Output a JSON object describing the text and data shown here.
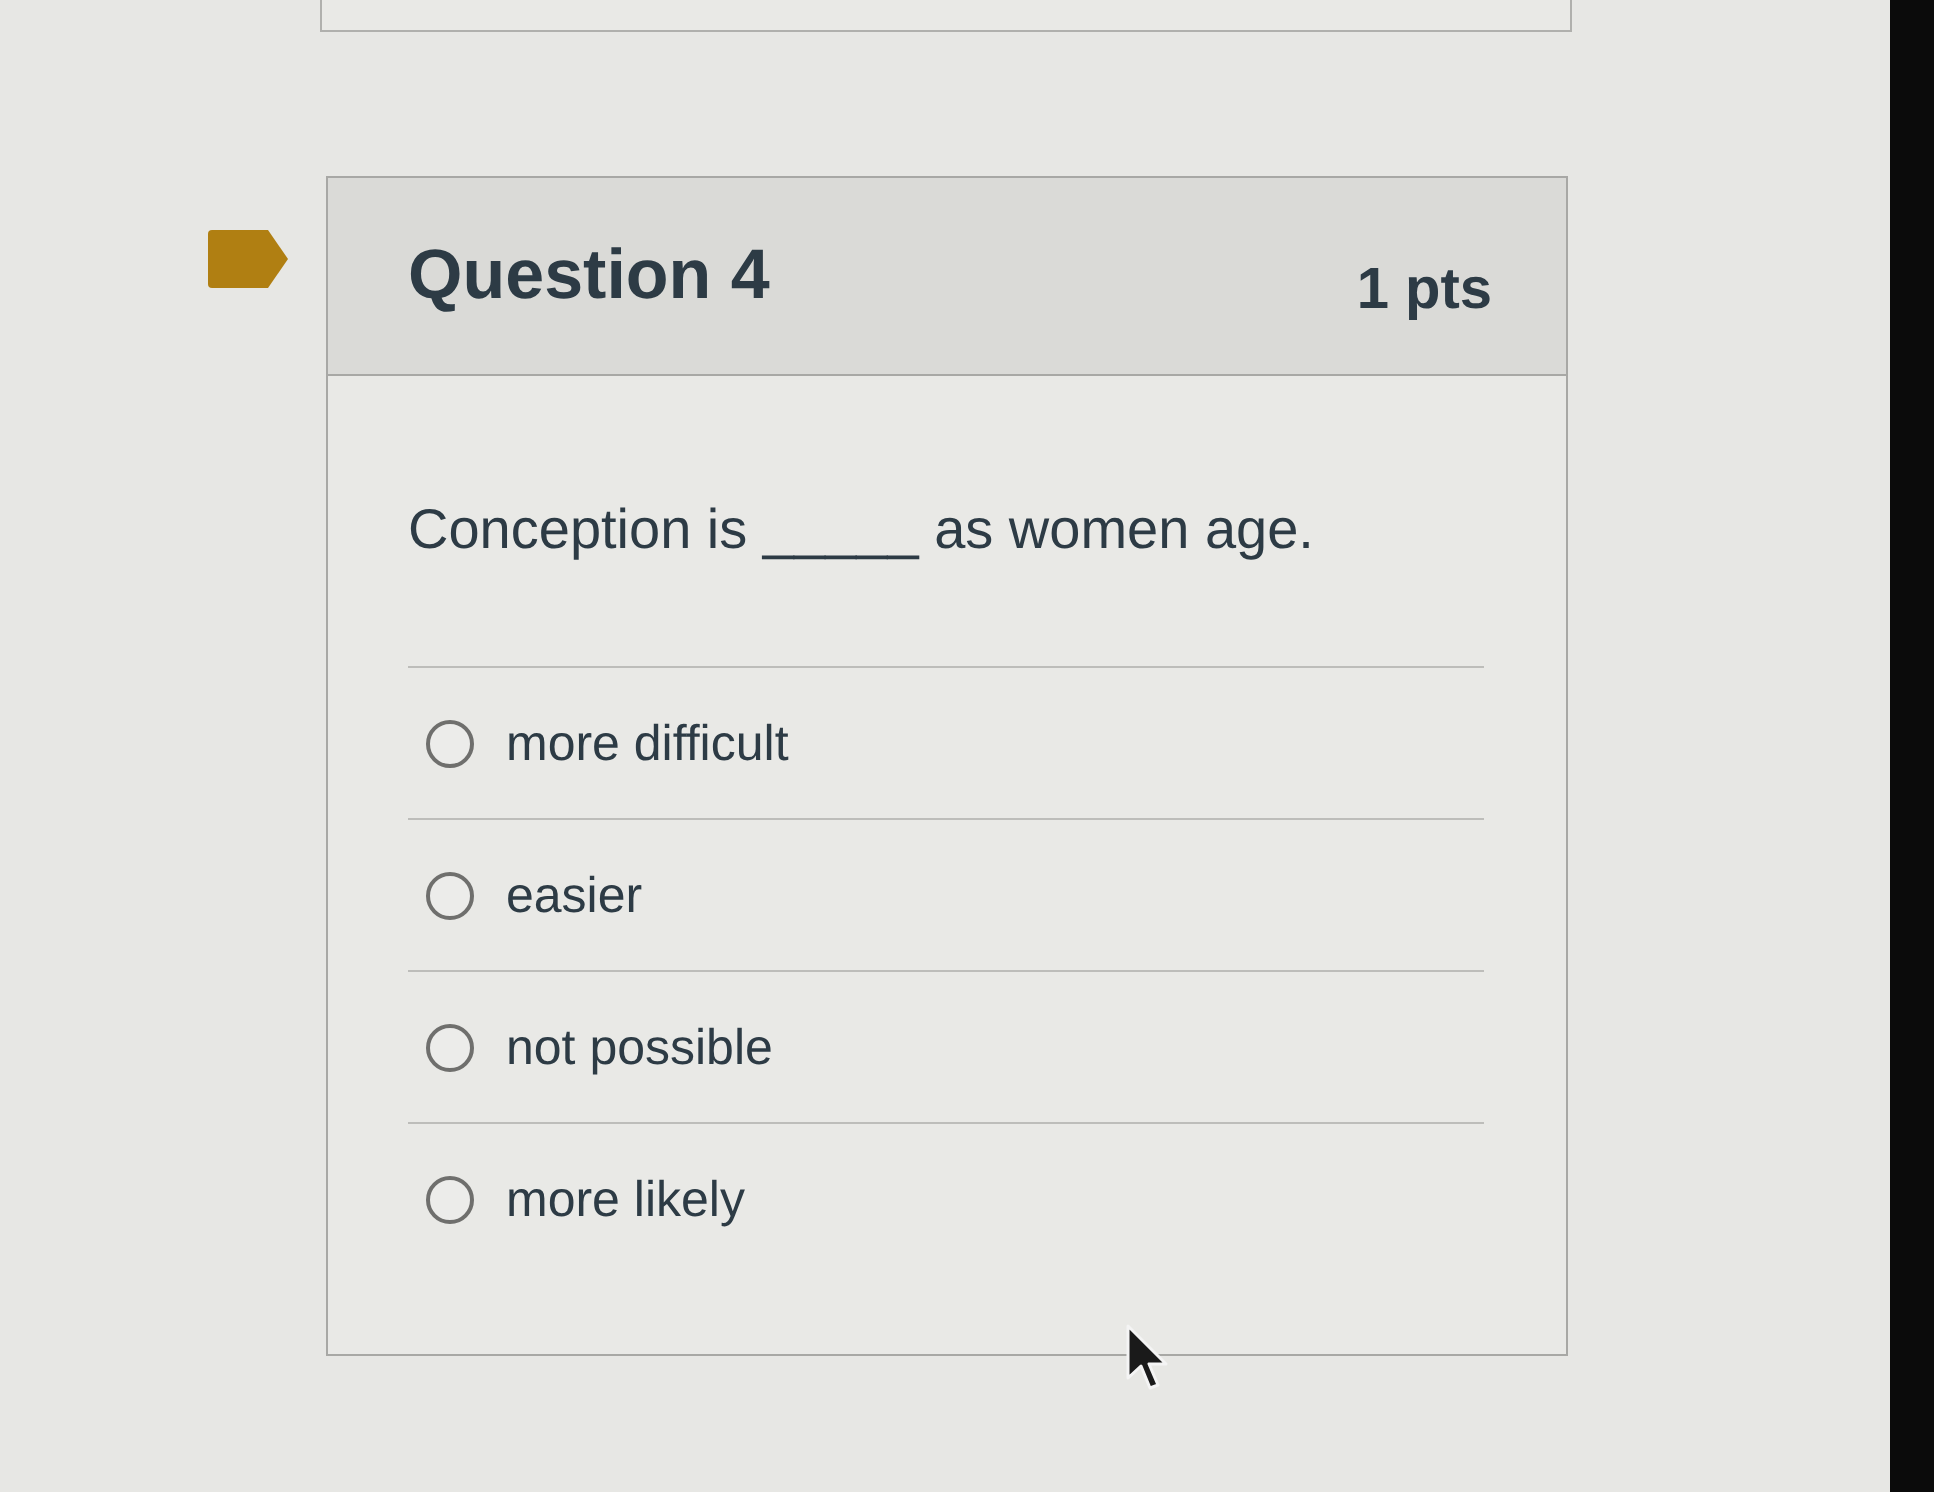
{
  "question": {
    "title": "Question 4",
    "points": "1 pts",
    "text": "Conception is _____ as women age.",
    "answers": [
      {
        "label": "more difficult",
        "selected": false
      },
      {
        "label": "easier",
        "selected": false
      },
      {
        "label": "not possible",
        "selected": false
      },
      {
        "label": "more likely",
        "selected": false
      }
    ]
  }
}
